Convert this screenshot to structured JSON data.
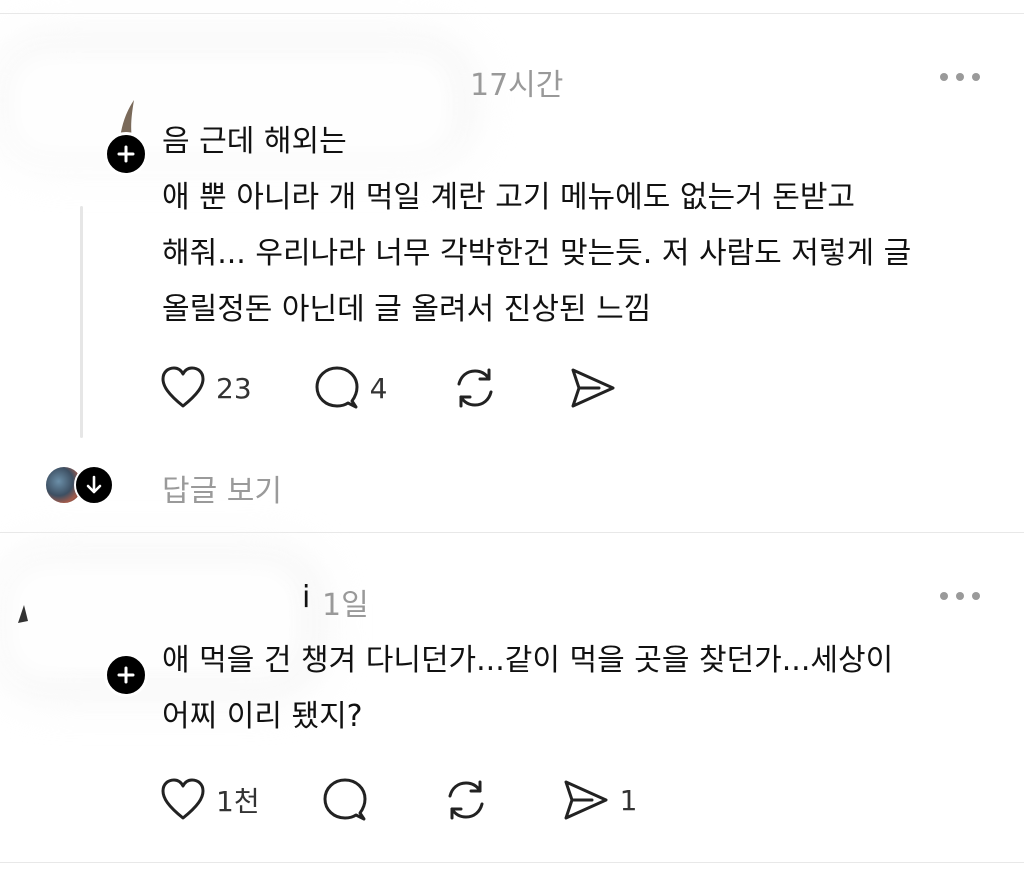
{
  "posts": [
    {
      "time": "17시간",
      "text": "음 근데 해외는\n애 뿐 아니라 개 먹일 계란 고기 메뉴에도 없는거 돈받고\n해줘... 우리나라 너무 각박한건 맞는듯. 저 사람도 저렇게 글\n올릴정돈 아닌데 글 올려서 진상된 느낌",
      "likes": "23",
      "comments": "4",
      "reposts": "",
      "shares": "",
      "reply_link": "답글 보기"
    },
    {
      "name_tail": "i",
      "time": "1일",
      "text": "애 먹을 건 챙겨 다니던가...같이 먹을 곳을 찾던가...세상이\n어찌 이리 됐지?",
      "likes": "1천",
      "comments": "",
      "reposts": "",
      "shares": "1"
    }
  ],
  "icons": {
    "like": "heart-icon",
    "comment": "comment-bubble-icon",
    "repost": "repost-icon",
    "share": "send-icon",
    "more": "more-dots-icon",
    "follow": "plus-icon",
    "expand": "arrow-down-icon"
  },
  "colors": {
    "text": "#111111",
    "muted": "#999999",
    "divider": "#e8e8e8"
  }
}
